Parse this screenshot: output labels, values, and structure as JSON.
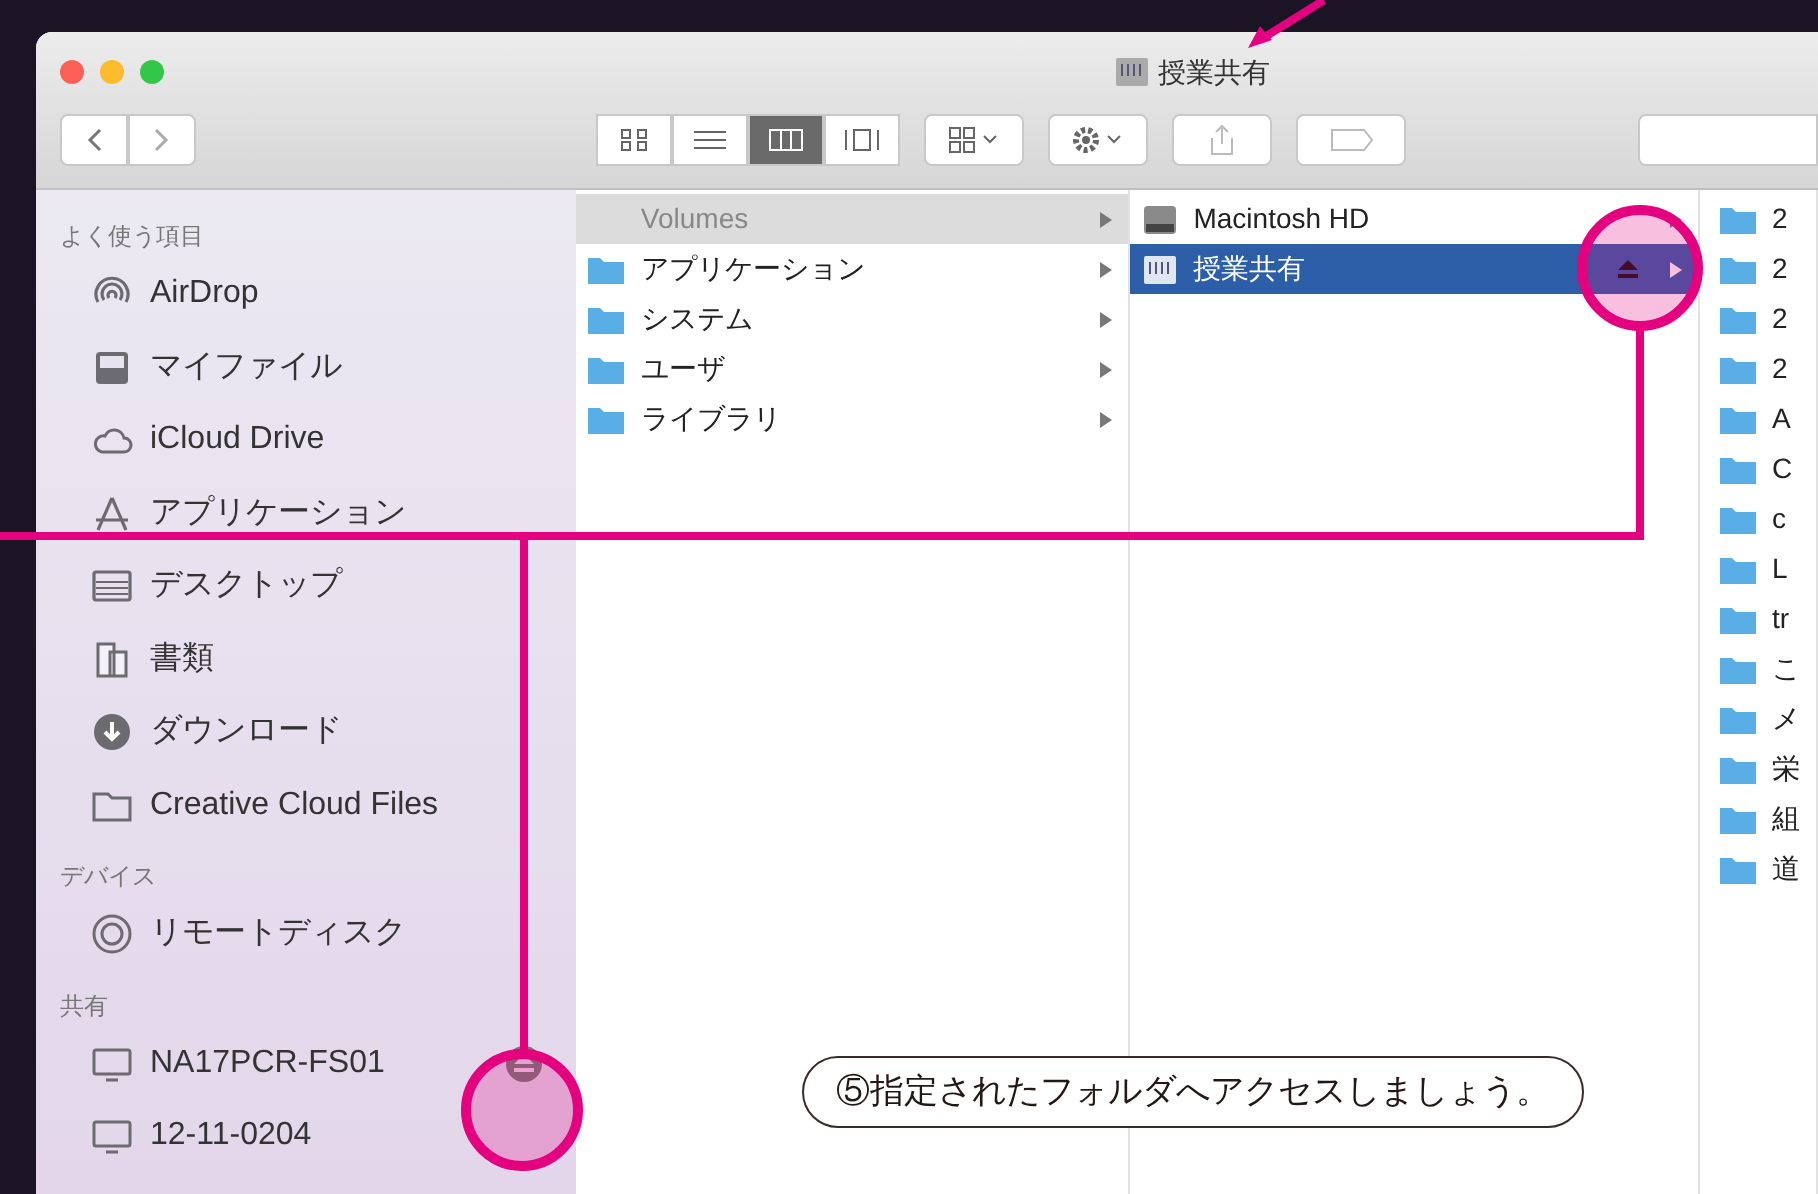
{
  "window": {
    "title": "授業共有"
  },
  "toolbar": {
    "view_modes": [
      {
        "kind": "icons",
        "selected": false
      },
      {
        "kind": "list",
        "selected": false
      },
      {
        "kind": "columns",
        "selected": true
      },
      {
        "kind": "gallery",
        "selected": false
      }
    ]
  },
  "sidebar": {
    "sections": [
      {
        "heading": "よく使う項目",
        "items": [
          {
            "label": "AirDrop",
            "kind": "airdrop"
          },
          {
            "label": "マイファイル",
            "kind": "files"
          },
          {
            "label": "iCloud Drive",
            "kind": "cloud"
          },
          {
            "label": "アプリケーション",
            "kind": "apps"
          },
          {
            "label": "デスクトップ",
            "kind": "desktop"
          },
          {
            "label": "書類",
            "kind": "documents"
          },
          {
            "label": "ダウンロード",
            "kind": "download"
          },
          {
            "label": "Creative Cloud Files",
            "kind": "folder"
          }
        ]
      },
      {
        "heading": "デバイス",
        "items": [
          {
            "label": "リモートディスク",
            "kind": "disc"
          }
        ]
      },
      {
        "heading": "共有",
        "items": [
          {
            "label": "NA17PCR-FS01",
            "kind": "computer",
            "ejectable": true
          },
          {
            "label": "12-11-0204",
            "kind": "computer",
            "ejectable": false
          }
        ]
      }
    ]
  },
  "columns": [
    {
      "items": [
        {
          "label": "Volumes",
          "kind": "plain",
          "selected": true
        },
        {
          "label": "アプリケーション",
          "kind": "folder",
          "selected": false
        },
        {
          "label": "システム",
          "kind": "folder",
          "selected": false
        },
        {
          "label": "ユーザ",
          "kind": "folder",
          "selected": false
        },
        {
          "label": "ライブラリ",
          "kind": "folder",
          "selected": false
        }
      ]
    },
    {
      "items": [
        {
          "label": "Macintosh HD",
          "kind": "disk",
          "selected": false,
          "ejectable": false
        },
        {
          "label": "授業共有",
          "kind": "server",
          "selected": true,
          "ejectable": true
        }
      ]
    },
    {
      "items": [
        {
          "label": "2",
          "kind": "folder",
          "selected": false
        },
        {
          "label": "2",
          "kind": "folder",
          "selected": false
        },
        {
          "label": "2",
          "kind": "folder",
          "selected": false
        },
        {
          "label": "2",
          "kind": "folder",
          "selected": false
        },
        {
          "label": "A",
          "kind": "folder",
          "selected": false
        },
        {
          "label": "C",
          "kind": "folder",
          "selected": false
        },
        {
          "label": "c",
          "kind": "folder",
          "selected": false
        },
        {
          "label": "L",
          "kind": "folder",
          "selected": false
        },
        {
          "label": "tr",
          "kind": "folder",
          "selected": false
        },
        {
          "label": "こ",
          "kind": "folder",
          "selected": false
        },
        {
          "label": "メ",
          "kind": "folder",
          "selected": false
        },
        {
          "label": "栄",
          "kind": "folder",
          "selected": false
        },
        {
          "label": "組",
          "kind": "folder",
          "selected": false
        },
        {
          "label": "道",
          "kind": "folder",
          "selected": false
        }
      ]
    }
  ],
  "callout": {
    "text": "⑤指定されたフォルダへアクセスしましょう。"
  }
}
